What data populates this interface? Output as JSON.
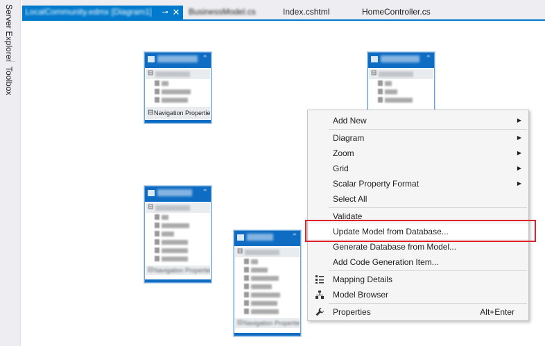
{
  "side_panel": {
    "server_explorer": "Server Explorer",
    "toolbox": "Toolbox"
  },
  "tabs": [
    {
      "label": "LocalCommunity.edmx [Diagram1]",
      "active": true
    },
    {
      "label": "BusinessModel.cs",
      "active": false
    },
    {
      "label": "Index.cshtml",
      "active": false
    },
    {
      "label": "HomeController.cs",
      "active": false
    }
  ],
  "tab_controls": {
    "pin": "⊸",
    "close": "✕"
  },
  "entities": [
    {
      "nav_label": "Navigation Properties"
    }
  ],
  "context_menu": {
    "items": [
      {
        "label": "Add New",
        "submenu": true,
        "icon": ""
      },
      {
        "label": "Diagram",
        "submenu": true,
        "icon": ""
      },
      {
        "label": "Zoom",
        "submenu": true,
        "icon": ""
      },
      {
        "label": "Grid",
        "submenu": true,
        "icon": ""
      },
      {
        "label": "Scalar Property Format",
        "submenu": true,
        "icon": ""
      },
      {
        "label": "Select All",
        "submenu": false,
        "icon": ""
      },
      {
        "label": "Validate",
        "submenu": false,
        "icon": ""
      },
      {
        "label": "Update Model from Database...",
        "submenu": false,
        "icon": "",
        "highlighted": true
      },
      {
        "label": "Generate Database from Model...",
        "submenu": false,
        "icon": ""
      },
      {
        "label": "Add Code Generation Item...",
        "submenu": false,
        "icon": ""
      },
      {
        "label": "Mapping Details",
        "submenu": false,
        "icon": "mapping-details-icon"
      },
      {
        "label": "Model Browser",
        "submenu": false,
        "icon": "model-browser-icon"
      },
      {
        "label": "Properties",
        "submenu": false,
        "icon": "wrench-icon",
        "shortcut": "Alt+Enter"
      }
    ],
    "submenu_arrow": "▶",
    "highlight_color": "#e2202a"
  },
  "colors": {
    "accent": "#007acc",
    "entity_header": "#0f6cc3"
  }
}
